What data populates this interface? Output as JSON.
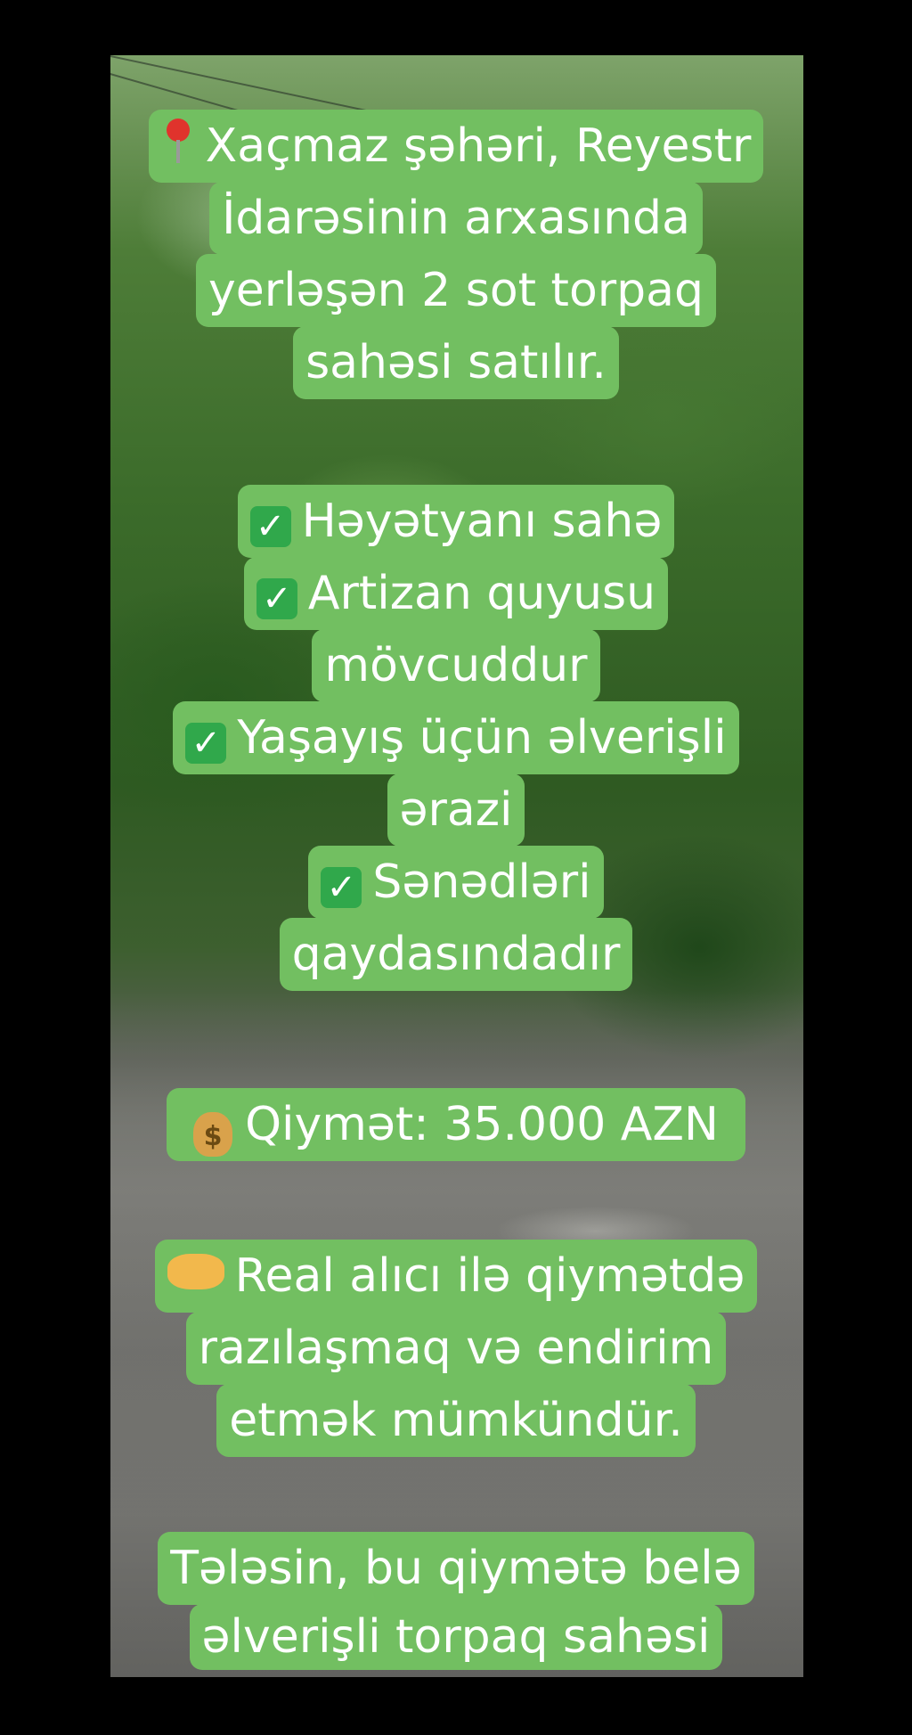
{
  "post": {
    "block1": {
      "icon": "round-pushpin-icon",
      "lines": [
        "Xaçmaz şəhəri, Reyestr",
        "İdarəsinin arxasında",
        "yerləşən 2 sot torpaq",
        "sahəsi satılır."
      ]
    },
    "block2": {
      "icon": "check-mark-button-icon",
      "lines": [
        "Həyətyanı sahə",
        "Artizan quyusu",
        "mövcuddur",
        "Yaşayış üçün əlverişli",
        "ərazi",
        "Sənədləri",
        "qaydasındadır"
      ]
    },
    "block3": {
      "icon": "money-bag-icon",
      "lines": [
        "Qiymət: 35.000 AZN"
      ]
    },
    "block4": {
      "icon": "handshake-icon",
      "lines": [
        "Real alıcı ilə qiymətdə",
        "razılaşmaq və endirim",
        "etmək mümkündür."
      ]
    },
    "block5": {
      "lines": [
        "Tələsin, bu qiymətə belə",
        "əlverişli torpaq sahəsi"
      ]
    },
    "colors": {
      "label_background": "#72bf61",
      "text": "#ffffff",
      "check_box": "#30a84b",
      "frame_background": "#000000"
    }
  }
}
